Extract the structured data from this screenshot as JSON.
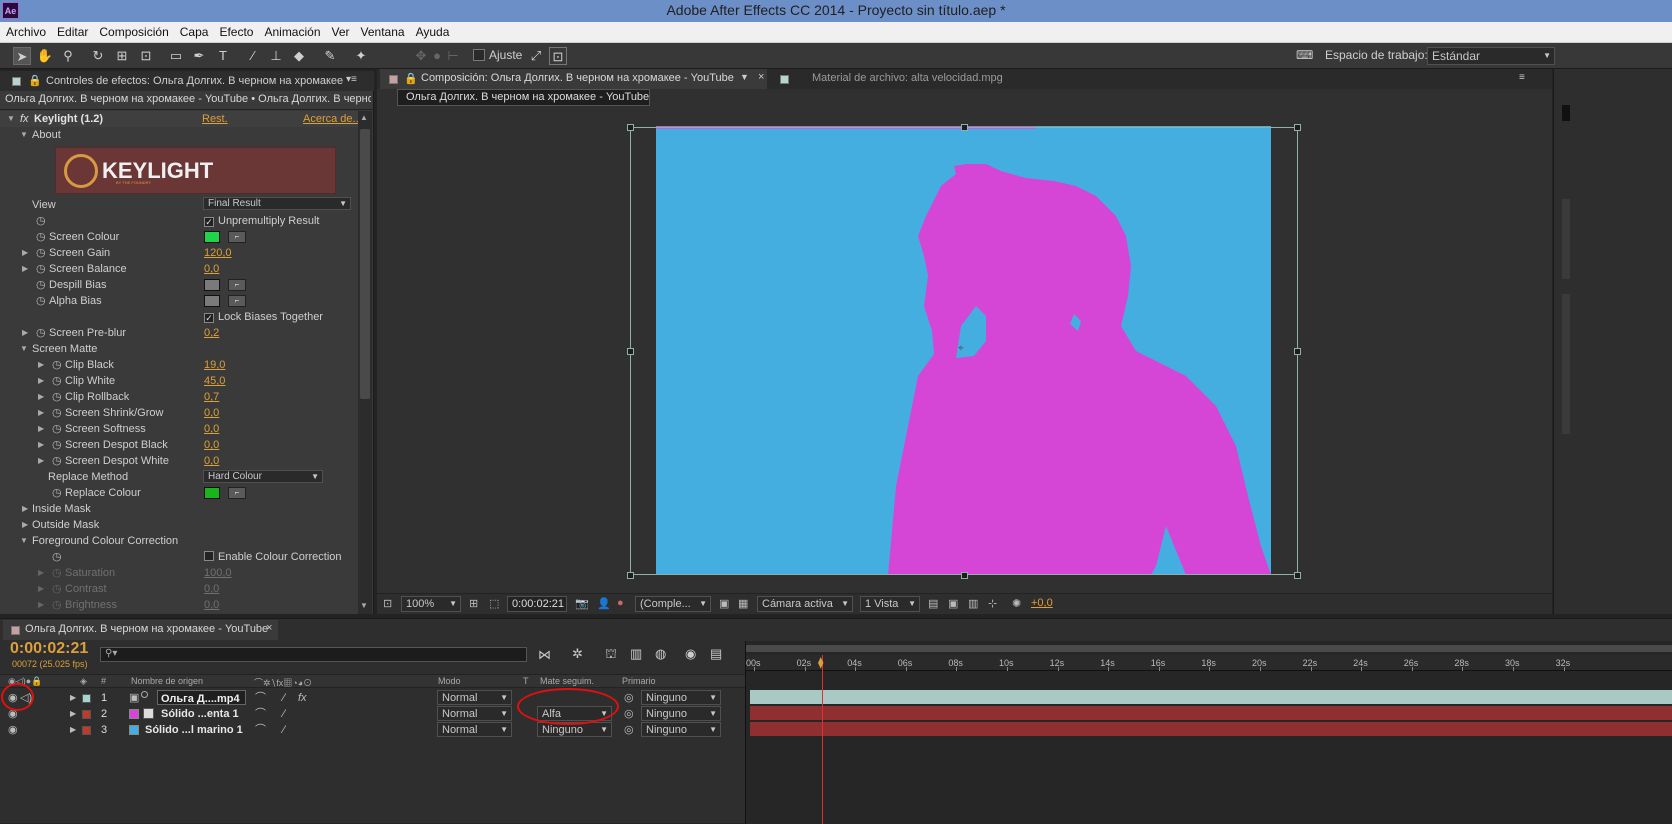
{
  "window": {
    "app_icon": "Ae",
    "title": "Adobe After Effects CC 2014 - Proyecto sin título.aep *"
  },
  "menu": [
    "Archivo",
    "Editar",
    "Composición",
    "Capa",
    "Efecto",
    "Animación",
    "Ver",
    "Ventana",
    "Ayuda"
  ],
  "toolbar": {
    "snap_label": "Ajuste",
    "workspace_label": "Espacio de trabajo:",
    "workspace_value": "Estándar"
  },
  "effects_panel": {
    "tab_title": "Controles de efectos: Ольга Долгих. В черном на хромакее",
    "breadcrumb": "Ольга Долгих. В черном на хромакее - YouTube • Ольга Долгих. В черном",
    "effect_fx": "fx",
    "effect_name": "Keylight (1.2)",
    "reset_link": "Rest.",
    "about_link": "Acerca de...",
    "about_label": "About",
    "logo_text": "KEYLIGHT",
    "logo_sub": "BY THE FOUNDRY",
    "view_label": "View",
    "view_value": "Final Result",
    "unpremultiply_label": "Unpremultiply Result",
    "screen_colour_label": "Screen Colour",
    "screen_gain_label": "Screen Gain",
    "screen_gain_value": "120,0",
    "screen_balance_label": "Screen Balance",
    "screen_balance_value": "0,0",
    "despill_bias_label": "Despill Bias",
    "alpha_bias_label": "Alpha Bias",
    "lock_biases_label": "Lock Biases Together",
    "screen_preblur_label": "Screen Pre-blur",
    "screen_preblur_value": "0,2",
    "screen_matte_label": "Screen Matte",
    "clip_black_label": "Clip Black",
    "clip_black_value": "19,0",
    "clip_white_label": "Clip White",
    "clip_white_value": "45,0",
    "clip_rollback_label": "Clip Rollback",
    "clip_rollback_value": "0,7",
    "shrink_grow_label": "Screen Shrink/Grow",
    "shrink_grow_value": "0,0",
    "softness_label": "Screen Softness",
    "softness_value": "0,0",
    "despot_black_label": "Screen Despot Black",
    "despot_black_value": "0,0",
    "despot_white_label": "Screen Despot White",
    "despot_white_value": "0,0",
    "replace_method_label": "Replace Method",
    "replace_method_value": "Hard Colour",
    "replace_colour_label": "Replace Colour",
    "inside_mask_label": "Inside Mask",
    "outside_mask_label": "Outside Mask",
    "fg_correction_label": "Foreground Colour Correction",
    "enable_correction_label": "Enable Colour Correction",
    "saturation_label": "Saturation",
    "saturation_value": "100,0",
    "contrast_label": "Contrast",
    "contrast_value": "0,0",
    "brightness_label": "Brightness",
    "brightness_value": "0,0"
  },
  "composition_panel": {
    "tab_comp": "Composición: Ольга Долгих. В черном на хромакее - YouTube",
    "tab_footage": "Material de archivo: alta velocidad.mpg",
    "comp_chip": "Ольга Долгих. В черном на хромакее - YouTube",
    "zoom": "100%",
    "timecode": "0:00:02:21",
    "resolution": "(Comple...",
    "camera": "Cámara activa",
    "views": "1 Vista",
    "exposure": "+0,0"
  },
  "timeline": {
    "tab_title": "Ольга Долгих. В черном на хромакее - YouTube",
    "timecode": "0:00:02:21",
    "frame_info": "00072 (25.025 fps)",
    "search_placeholder": "",
    "col_hash": "#",
    "col_source": "Nombre de origen",
    "col_mode": "Modo",
    "col_t": "T",
    "col_trkmat": "Mate seguim.",
    "col_parent": "Primario",
    "ruler_labels": [
      "00s",
      "02s",
      "04s",
      "06s",
      "08s",
      "10s",
      "12s",
      "14s",
      "16s",
      "18s",
      "20s",
      "22s",
      "24s",
      "26s",
      "28s",
      "30s",
      "32s"
    ],
    "layers": [
      {
        "num": "1",
        "name": "Ольга Д....mp4",
        "mode": "Normal",
        "trkmat": "",
        "parent": "Ninguno",
        "label_color": "#a9d3cf"
      },
      {
        "num": "2",
        "name": "Sólido ...enta 1",
        "mode": "Normal",
        "trkmat": "Alfa",
        "parent": "Ninguno",
        "label_color": "#c0392b"
      },
      {
        "num": "3",
        "name": "Sólido ...l marino 1",
        "mode": "Normal",
        "trkmat": "Ninguno",
        "parent": "Ninguno",
        "label_color": "#c0392b"
      }
    ],
    "playhead_time": "0:00:02:21"
  },
  "colors": {
    "screen_colour": "#1fd34a",
    "replace_colour": "#19b51c",
    "comp_bg": "#45aee0",
    "matte": "#d646d6",
    "accent": "#dca03a",
    "annotation": "#e01010"
  }
}
